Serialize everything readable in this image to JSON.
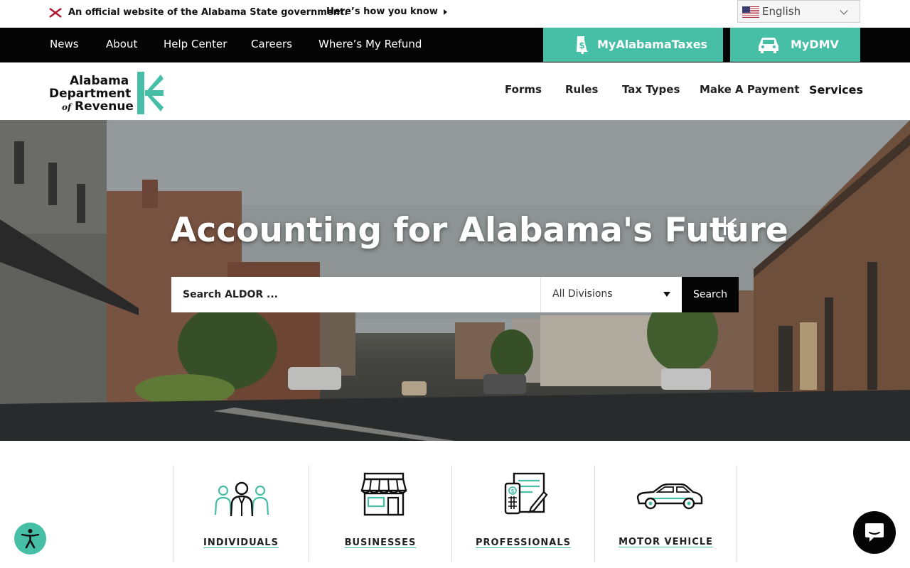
{
  "official_banner": {
    "text": "An official website of the Alabama State government.",
    "link": "Here’s how you know",
    "flag_icon": "alabama-flag-icon"
  },
  "language": {
    "selected": "English",
    "flag_icon": "us-flag-icon"
  },
  "utility_nav": {
    "items": [
      "News",
      "About",
      "Help Center",
      "Careers",
      "Where’s My Refund"
    ]
  },
  "portals": {
    "my_alabama_taxes": "MyAlabamaTaxes",
    "my_dmv": "MyDMV",
    "accent_color": "#47bfa7"
  },
  "logo": {
    "line1": "Alabama",
    "line2": "Department",
    "line3_prefix": "of",
    "line3": "Revenue"
  },
  "main_nav": {
    "items": [
      "Forms",
      "Rules",
      "Tax Types",
      "Make A Payment",
      "Services"
    ]
  },
  "hero": {
    "title": "Accounting for Alabama's Future",
    "search_placeholder": "Search ALDOR ...",
    "division_selected": "All Divisions",
    "search_button": "Search"
  },
  "categories": [
    {
      "label": "INDIVIDUALS",
      "icon": "people-group-icon"
    },
    {
      "label": "BUSINESSES",
      "icon": "storefront-icon"
    },
    {
      "label": "PROFESSIONALS",
      "icon": "calculator-document-icon"
    },
    {
      "label": "MOTOR VEHICLE",
      "icon": "car-icon"
    }
  ]
}
